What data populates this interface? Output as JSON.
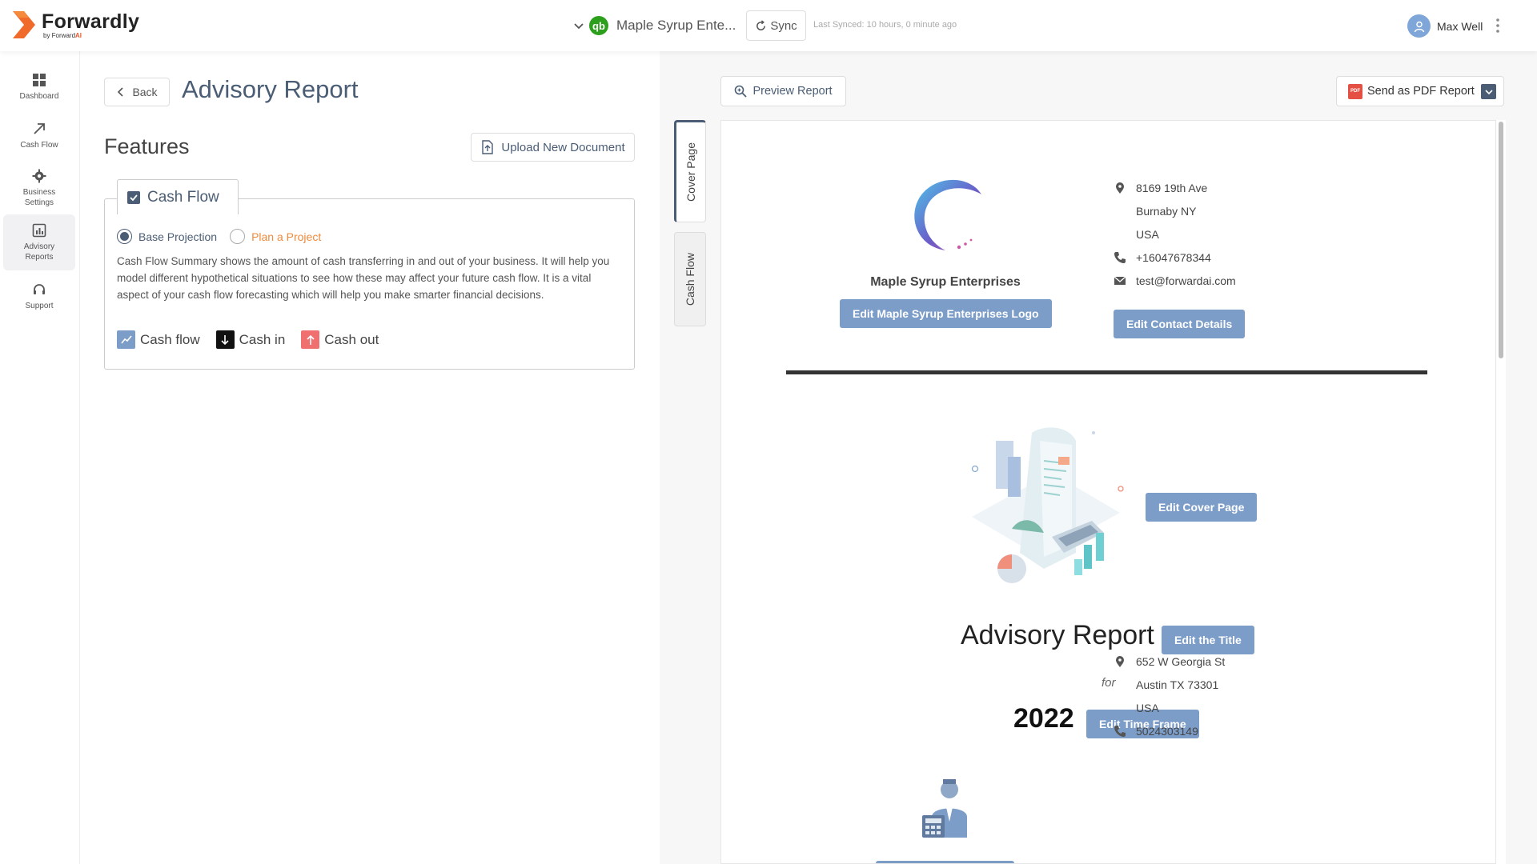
{
  "app": {
    "brand": "Forwardly",
    "brand_sub_prefix": "by Forward",
    "brand_sub_suffix": "AI",
    "company_name": "Maple Syrup Ente...",
    "qb_label": "qb",
    "sync_label": "Sync",
    "last_synced": "Last Synced: 10 hours, 0 minute ago",
    "user_name": "Max Well"
  },
  "sidebar": {
    "items": [
      {
        "label": "Dashboard",
        "icon": "dashboard-icon"
      },
      {
        "label": "Cash Flow",
        "icon": "arrow-up-right-icon"
      },
      {
        "label": "Business Settings",
        "icon": "gear-icon"
      },
      {
        "label": "Advisory Reports",
        "icon": "report-icon",
        "active": true
      },
      {
        "label": "Support",
        "icon": "headset-icon"
      }
    ]
  },
  "main": {
    "back_label": "Back",
    "title": "Advisory Report",
    "features_title": "Features",
    "upload_label": "Upload New Document",
    "feature": {
      "name": "Cash Flow",
      "checked": true,
      "options": [
        {
          "label": "Base Projection",
          "selected": true
        },
        {
          "label": "Plan a Project",
          "selected": false
        }
      ],
      "description": "Cash Flow Summary shows the amount of cash transferring in and out of your business. It will help you model different hypothetical situations to see how these may affect your future cash flow. It is a vital aspect of your cash flow forecasting which will help you make smarter financial decisions.",
      "legend": [
        {
          "label": "Cash flow",
          "color": "#7d9dc9"
        },
        {
          "label": "Cash in",
          "color": "#111111"
        },
        {
          "label": "Cash out",
          "color": "#f07070"
        }
      ]
    }
  },
  "vtabs": [
    {
      "label": "Cover Page",
      "active": true
    },
    {
      "label": "Cash Flow",
      "active": false
    }
  ],
  "preview": {
    "preview_label": "Preview Report",
    "pdf_label": "Send as PDF Report",
    "pdf_icon_text": "PDF",
    "company_name": "Maple Syrup Enterprises",
    "edit_logo_label": "Edit Maple Syrup Enterprises Logo",
    "contact": {
      "address1": "8169 19th Ave",
      "address2": "Burnaby NY",
      "country": "USA",
      "phone": "+16047678344",
      "email": "test@forwardai.com"
    },
    "edit_contact_label": "Edit Contact Details",
    "edit_cover_label": "Edit Cover Page",
    "report_title": "Advisory Report",
    "edit_title_label": "Edit the Title",
    "for_text": "for",
    "year": "2022",
    "edit_timeframe_label": "Edit Time Frame",
    "advisor_contact": {
      "address1": "652 W Georgia St",
      "address2": "Austin TX  73301",
      "country": "USA",
      "phone": "5024303149"
    }
  },
  "colors": {
    "accent": "#4a5d75",
    "button": "#7d9dc9",
    "orange": "#f08a3c",
    "brand_orange": "#e8592c"
  }
}
